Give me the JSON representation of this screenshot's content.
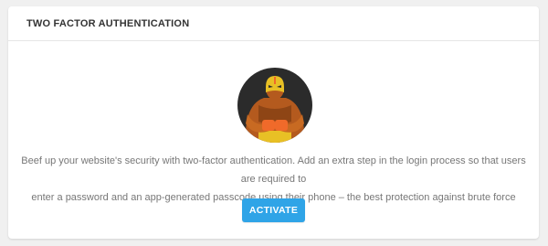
{
  "panel": {
    "title": "TWO FACTOR AUTHENTICATION"
  },
  "illustration": {
    "icon": "masked-wrestler-icon"
  },
  "content": {
    "description_line1": "Beef up your website's security with two-factor authentication. Add an extra step in the login process so that users are required to",
    "description_line2": "enter a password and an app-generated passcode using their phone – the best protection against brute force attacks."
  },
  "actions": {
    "activate_label": "ACTIVATE"
  },
  "colors": {
    "accent": "#2fa4e7",
    "illustration_bg": "#2b2b2b",
    "skin": "#b45a1e",
    "mask": "#e8c025",
    "gloves": "#f06a2a"
  }
}
